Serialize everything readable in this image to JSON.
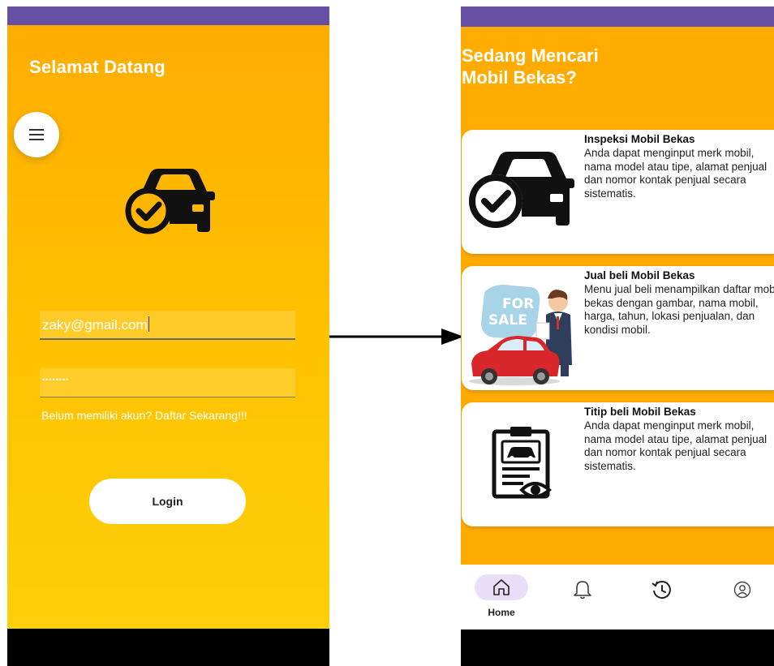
{
  "login": {
    "title": "Selamat Datang",
    "email_value": "zaky@gmail.com",
    "password_value": "••••••••",
    "signup_text": "Belum memiliki akun? Daftar Sekarang!!!",
    "login_label": "Login"
  },
  "home": {
    "title_line1": "Sedang Mencari",
    "title_line2": "Mobil Bekas?",
    "cards": [
      {
        "title": "Inspeksi Mobil Bekas",
        "description": "Anda dapat menginput merk mobil, nama model atau tipe, alamat penjual dan nomor kontak penjual secara sistematis."
      },
      {
        "title": "Jual beli Mobil Bekas",
        "description": "Menu jual beli menampilkan daftar mobil bekas dengan gambar, nama mobil, harga, tahun, lokasi penjualan, dan kondisi mobil."
      },
      {
        "title": "Titip beli Mobil Bekas",
        "description": "Anda dapat menginput merk mobil, nama model atau tipe, alamat penjual dan nomor kontak penjual secara sistematis."
      }
    ],
    "sale_sign": {
      "line1": "FOR",
      "line2": "SALE"
    },
    "nav": {
      "home_label": "Home"
    }
  },
  "colors": {
    "status_bar": "#6750a4",
    "background_orange": "#ffab00",
    "nav_pill": "#e8def8"
  },
  "icons": [
    "menu-icon",
    "car-check-icon",
    "car-illustration",
    "document-car-eye-icon",
    "home-icon",
    "bell-icon",
    "history-icon",
    "profile-icon"
  ]
}
